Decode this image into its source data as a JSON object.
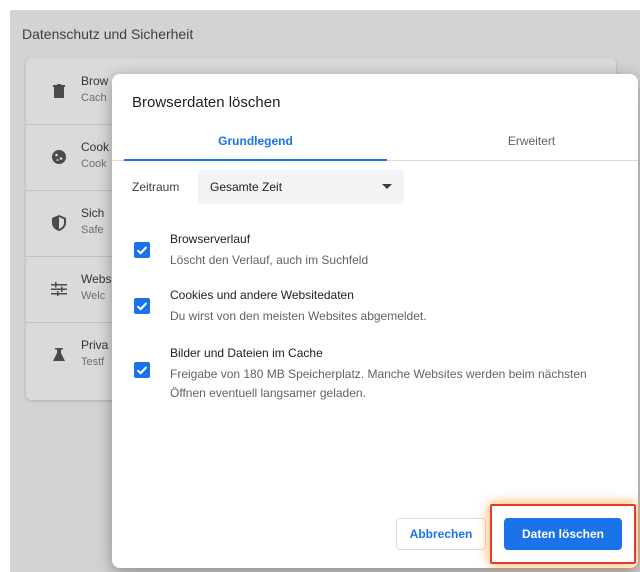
{
  "page": {
    "title": "Datenschutz und Sicherheit"
  },
  "background_rows": [
    {
      "title": "Brow",
      "subtitle": "Cach",
      "icon": "trash-icon"
    },
    {
      "title": "Cook",
      "subtitle": "Cook",
      "icon": "cookie-icon"
    },
    {
      "title": "Sich",
      "subtitle": "Safe",
      "icon": "shield-icon"
    },
    {
      "title": "Webs",
      "subtitle": "Welc",
      "icon": "sliders-icon"
    },
    {
      "title": "Priva",
      "subtitle": "Testf",
      "icon": "flask-icon"
    }
  ],
  "dialog": {
    "title": "Browserdaten löschen",
    "tabs": [
      {
        "label": "Grundlegend",
        "active": true
      },
      {
        "label": "Erweitert",
        "active": false
      }
    ],
    "time_range": {
      "label": "Zeitraum",
      "value": "Gesamte Zeit"
    },
    "options": [
      {
        "label": "Browserverlauf",
        "description": "Löscht den Verlauf, auch im Suchfeld",
        "checked": true
      },
      {
        "label": "Cookies und andere Websitedaten",
        "description": "Du wirst von den meisten Websites abgemeldet.",
        "checked": true
      },
      {
        "label": "Bilder und Dateien im Cache",
        "description": "Freigabe von 180 MB Speicherplatz. Manche Websites werden beim nächsten Öffnen eventuell langsamer geladen.",
        "checked": true
      }
    ],
    "buttons": {
      "cancel": "Abbrechen",
      "confirm": "Daten löschen"
    }
  },
  "colors": {
    "accent": "#1a73e8",
    "highlight": "#e53935"
  }
}
